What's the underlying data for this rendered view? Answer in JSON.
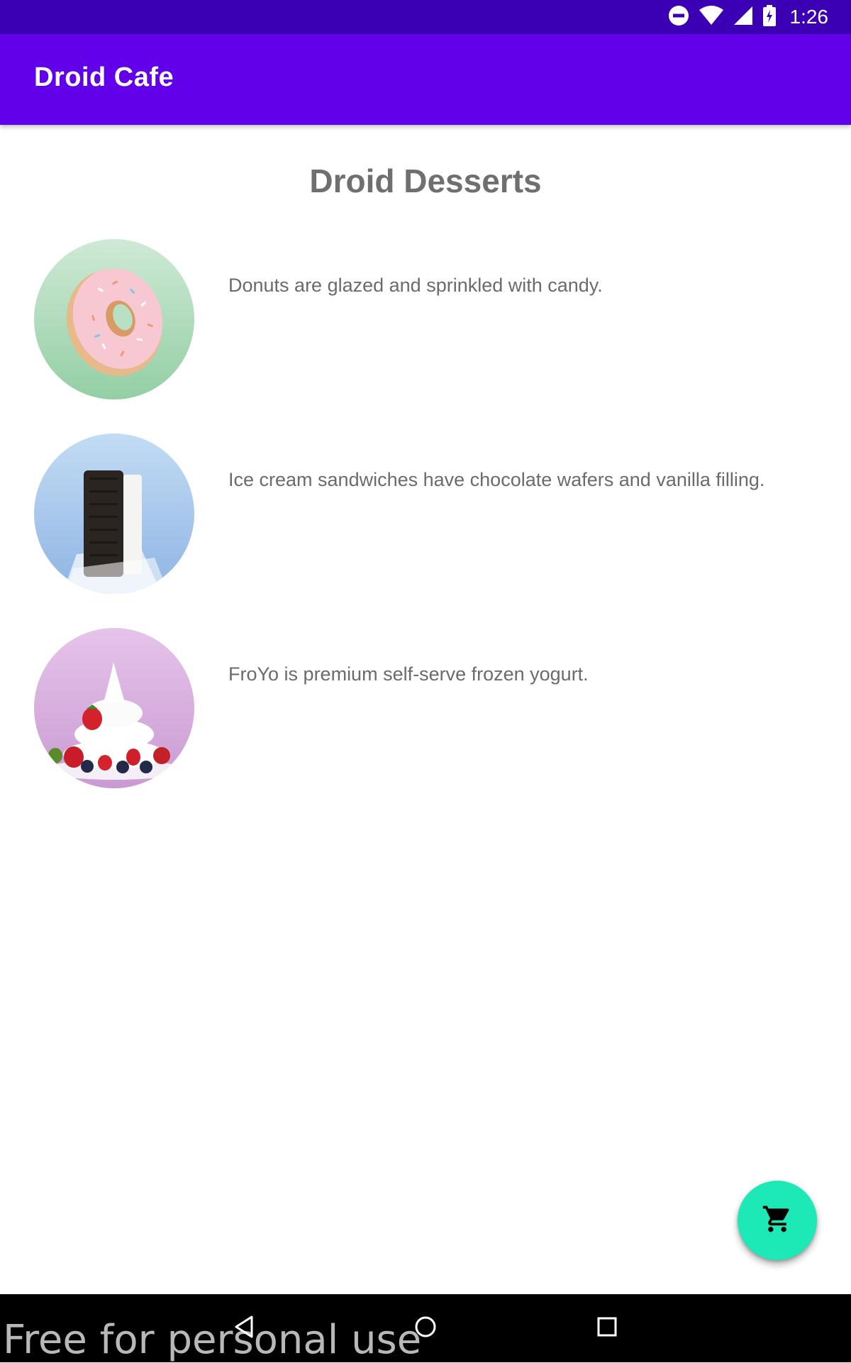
{
  "status_bar": {
    "time": "1:26",
    "icons": [
      "do-not-disturb-icon",
      "wifi-icon",
      "cell-signal-icon",
      "battery-icon"
    ]
  },
  "app_bar": {
    "title": "Droid Cafe",
    "color": "#6200ea"
  },
  "main": {
    "heading": "Droid Desserts",
    "desserts": [
      {
        "name": "donut",
        "image_icon": "donut-image",
        "description": "Donuts are glazed and sprinkled with candy."
      },
      {
        "name": "ice-cream-sandwich",
        "image_icon": "ice-cream-sandwich-image",
        "description": "Ice cream sandwiches have chocolate wafers and vanilla filling."
      },
      {
        "name": "froyo",
        "image_icon": "froyo-image",
        "description": "FroYo is premium self-serve frozen yogurt."
      }
    ]
  },
  "fab": {
    "icon": "shopping-cart-icon",
    "color": "#1de9b6"
  },
  "nav_bar": {
    "icons": [
      "back-icon",
      "home-icon",
      "recents-icon"
    ]
  },
  "watermark": "Free for personal use"
}
